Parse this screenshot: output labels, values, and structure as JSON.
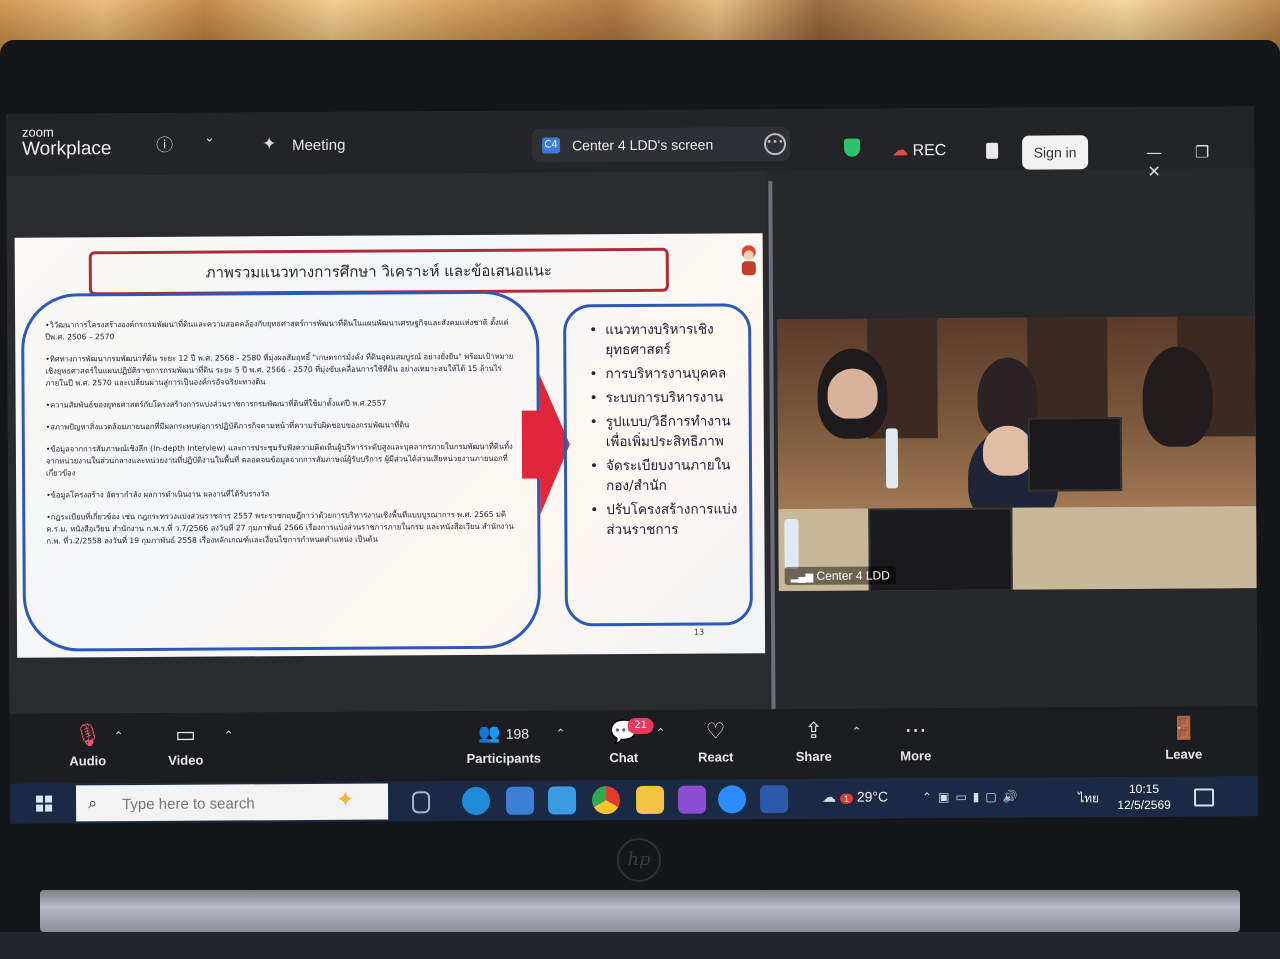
{
  "window": {
    "brand_small": "zoom",
    "brand_large": "Workplace",
    "meeting_label": "Meeting",
    "share_badge": "C4",
    "share_label": "Center 4 LDD's screen",
    "rec_label": "REC",
    "sign_in_label": "Sign in"
  },
  "slide": {
    "title": "ภาพรวมแนวทางการศึกษา วิเคราะห์ และข้อเสนอแนะ",
    "left_items": [
      "•วิวัฒนาการโครงสร้างองค์กรกรมพัฒนาที่ดินและความสอดคล้องกับยุทธศาสตร์การพัฒนาที่ดินในแผนพัฒนาเศรษฐกิจและสังคมแห่งชาติ ตั้งแต่ ปีพ.ศ. 2506 – 2570",
      "•ทิศทางการพัฒนากรมพัฒนาที่ดิน ระยะ 12 ปี พ.ศ. 2568 - 2580 ที่มุ่งผลสัมฤทธิ์ \"เกษตรกรมั่งคั่ง ที่ดินอุดมสมบูรณ์ อย่างยั่งยืน\" พร้อมเป้าหมายเชิงยุทธศาสตร์ในแผนปฏิบัติราชการกรมพัฒนาที่ดิน ระยะ 5 ปี พ.ศ. 2566 - 2570 ที่มุ่งขับเคลื่อนการใช้ที่ดิน อย่างเหมาะสมให้ได้ 15 ล้านไร่ ภายในปี พ.ศ. 2570 และเปลี่ยนผ่านสู่การเป็นองค์กรอัจฉริยะทางดิน",
      "•ความสัมพันธ์ของยุทธศาสตร์กับโครงสร้างการแบ่งส่วนราชการกรมพัฒนาที่ดินที่ใช้มาตั้งแต่ปี พ.ศ.2557",
      "•สภาพปัญหาสิ่งแวดล้อมภายนอกที่มีผลกระทบต่อการปฏิบัติภารกิจตามหน้าที่ความรับผิดชอบของกรมพัฒนาที่ดิน",
      "•ข้อมูลจากการสัมภาษณ์เชิงลึก (In-depth Interview) และการประชุมรับฟังความคิดเห็นผู้บริหารระดับสูงและบุคลากรภายในกรมพัฒนาที่ดินทั้งจากหน่วยงานในส่วนกลางและหน่วยงานที่ปฏิบัติงานในพื้นที่ ตลอดจนข้อมูลจากการสัมภาษณ์ผู้รับบริการ ผู้มีส่วนได้ส่วนเสียหน่วยงานภายนอกที่เกี่ยวข้อง",
      "•ข้อมูลโครงสร้าง อัตรากำลัง ผลการดำเนินงาน ผลงานที่ได้รับรางวัล",
      "•กฎระเบียบที่เกี่ยวข้อง เช่น กฎกระทรวงแบ่งส่วนราชการ 2557 พระราชกฤษฎีกาว่าด้วยการบริหารงานเชิงพื้นที่แบบบูรณาการ พ.ศ. 2565 มติ ค.ร.ม. หนังสือเวียน สำนักงาน ก.พ.ร.ที่ ว.7/2566 ลงวันที่ 27 กุมภาพันธ์ 2566 เรื่องการแบ่งส่วนราชการภายในกรม และหนังสือเวียน สำนักงาน ก.พ. ที่ว.2/2558 ลงวันที่ 19 กุมภาพันธ์ 2558 เรื่องหลักเกณฑ์และเงื่อนไขการกำหนดตำแหน่ง เป็นต้น"
    ],
    "right_items": [
      "แนวทางบริหารเชิงยุทธศาสตร์",
      "การบริหารงานบุคคล",
      "ระบบการบริหารงาน",
      "รูปแบบ/วิธีการทำงานเพื่อเพิ่มประสิทธิภาพ",
      "จัดระเบียบงานภายในกอง/สำนัก",
      "ปรับโครงสร้างการแบ่งส่วนราชการ"
    ],
    "page_number": "13"
  },
  "video": {
    "participant_label": "Center 4 LDD"
  },
  "toolbar": {
    "audio": "Audio",
    "video": "Video",
    "participants": "Participants",
    "participants_count": "198",
    "chat": "Chat",
    "chat_badge": "21",
    "react": "React",
    "share": "Share",
    "more": "More",
    "leave": "Leave"
  },
  "taskbar": {
    "search_placeholder": "Type here to search",
    "weather_temp": "29°C",
    "weather_alert": "1",
    "language": "ไทย",
    "time": "10:15",
    "date": "12/5/2569"
  },
  "hardware": {
    "brand": "hp"
  },
  "colors": {
    "slide_border_blue": "#2e58b8",
    "slide_title_red": "#b02a3a",
    "arrow_red": "#e0263a",
    "rec_red": "#e54b4b",
    "shield_green": "#2bc46a",
    "chat_badge_pink": "#e83a5a"
  }
}
